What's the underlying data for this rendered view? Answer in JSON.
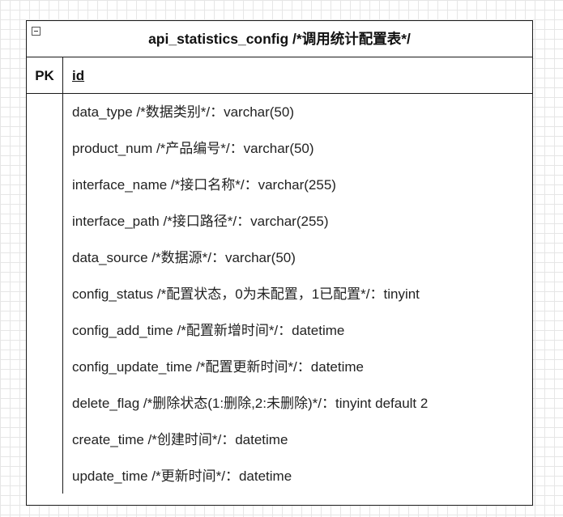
{
  "entity": {
    "title": "api_statistics_config /*调用统计配置表*/",
    "pk_label": "PK",
    "pk_field": "id",
    "fields": [
      "data_type /*数据类别*/：varchar(50)",
      "product_num /*产品编号*/：varchar(50)",
      "interface_name /*接口名称*/：varchar(255)",
      "interface_path /*接口路径*/：varchar(255)",
      "data_source /*数据源*/：varchar(50)",
      "config_status /*配置状态，0为未配置，1已配置*/：tinyint",
      "config_add_time /*配置新增时间*/：datetime",
      "config_update_time /*配置更新时间*/：datetime",
      "delete_flag /*删除状态(1:删除,2:未删除)*/：tinyint default 2",
      "create_time /*创建时间*/：datetime",
      "update_time /*更新时间*/：datetime"
    ]
  }
}
